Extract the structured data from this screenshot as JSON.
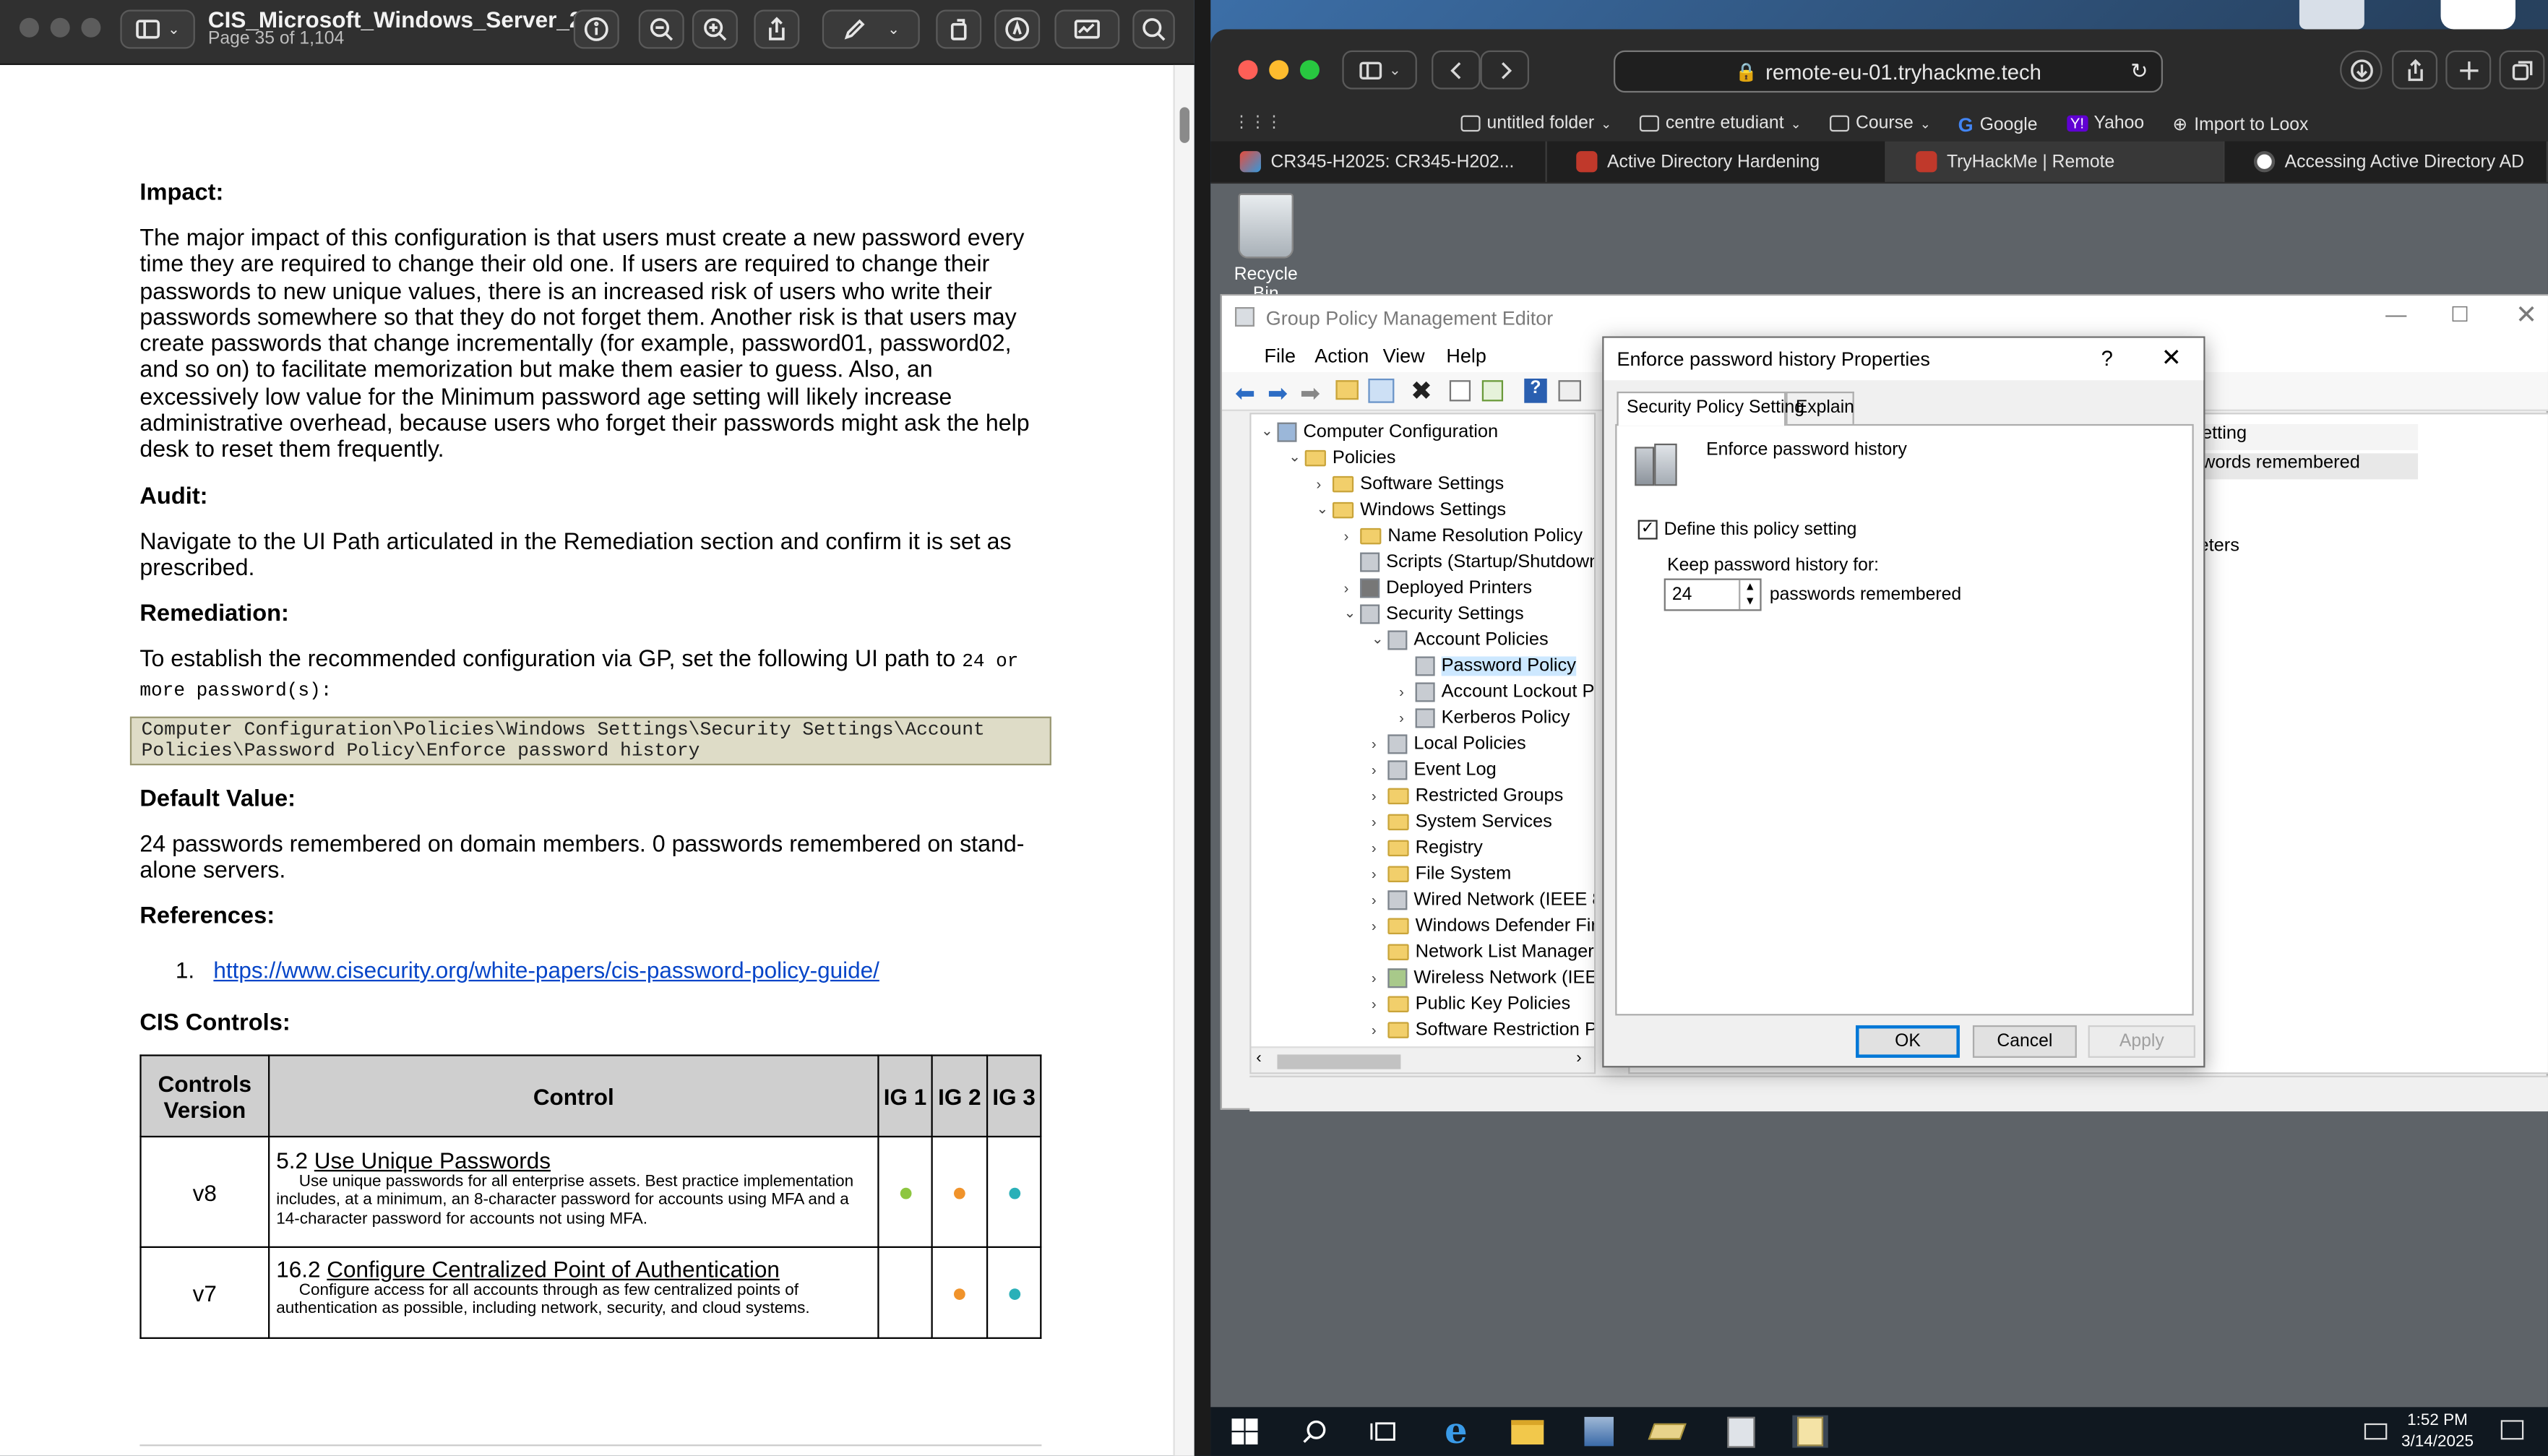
{
  "preview": {
    "title": "CIS_Microsoft_Windows_Server_2...",
    "page_indicator": "Page 35 of 1,104"
  },
  "document": {
    "impact_heading": "Impact:",
    "impact_text": "The major impact of this configuration is that users must create a new password every time they are required to change their old one. If users are required to change their passwords to new unique values, there is an increased risk of users who write their passwords somewhere so that they do not forget them. Another risk is that users may create passwords that change incrementally (for example, password01, password02, and so on) to facilitate memorization but make them easier to guess. Also, an excessively low value for the Minimum password age setting will likely increase administrative overhead, because users who forget their passwords might ask the help desk to reset them frequently.",
    "audit_heading": "Audit:",
    "audit_text": "Navigate to the UI Path articulated in the Remediation section and confirm it is set as prescribed.",
    "remediation_heading": "Remediation:",
    "remediation_text": "To establish the recommended configuration via GP, set the following UI path to",
    "remediation_value": "24 or more password(s):",
    "remediation_path": "Computer Configuration\\Policies\\Windows Settings\\Security Settings\\Account Policies\\Password Policy\\Enforce password history",
    "default_heading": "Default Value:",
    "default_text": "24 passwords remembered on domain members. 0 passwords remembered on stand-alone servers.",
    "references_heading": "References:",
    "reference_number": "1.",
    "reference_url": "https://www.cisecurity.org/white-papers/cis-password-policy-guide/",
    "cis_heading": "CIS Controls:",
    "table": {
      "headers": [
        "Controls Version",
        "Control",
        "IG 1",
        "IG 2",
        "IG 3"
      ],
      "rows": [
        {
          "version": "v8",
          "number": "5.2",
          "title": "Use Unique Passwords",
          "desc": "Use unique passwords for all enterprise assets. Best practice implementation includes, at a minimum, an 8-character password for accounts using MFA and a 14-character password for accounts not using MFA.",
          "ig": [
            true,
            true,
            true
          ]
        },
        {
          "version": "v7",
          "number": "16.2",
          "title": "Configure Centralized Point of Authentication",
          "desc": "Configure access for all accounts through as few centralized points of authentication as possible, including network, security, and cloud systems.",
          "ig": [
            false,
            true,
            true
          ]
        }
      ],
      "ig_colors": [
        "#8dc63f",
        "#f0932b",
        "#2ab0b8"
      ]
    }
  },
  "safari": {
    "url": "remote-eu-01.tryhackme.tech",
    "favorites": [
      "untitled folder",
      "centre etudiant",
      "Course",
      "Google",
      "Yahoo",
      "Import to Loox"
    ],
    "tabs": [
      "CR345-H2025: CR345-H202...",
      "Active Directory Hardening",
      "TryHackMe | Remote",
      "Accessing Active Directory AD"
    ]
  },
  "desktop": {
    "recycle_bin": "Recycle Bin",
    "clock_time": "1:52 PM",
    "clock_date": "3/14/2025"
  },
  "gpme": {
    "title": "Group Policy Management Editor",
    "menu": [
      "File",
      "Action",
      "View",
      "Help"
    ],
    "tree": [
      "Computer Configuration",
      "Policies",
      "Software Settings",
      "Windows Settings",
      "Name Resolution Policy",
      "Scripts (Startup/Shutdown",
      "Deployed Printers",
      "Security Settings",
      "Account Policies",
      "Password Policy",
      "Account Lockout P",
      "Kerberos Policy",
      "Local Policies",
      "Event Log",
      "Restricted Groups",
      "System Services",
      "Registry",
      "File System",
      "Wired Network (IEEE 8(",
      "Windows Defender Fire",
      "Network List Manager",
      "Wireless Network (IEEE",
      "Public Key Policies",
      "Software Restriction Pc"
    ],
    "right_pane": [
      "etting",
      "words remembered",
      "eters"
    ]
  },
  "dialog": {
    "title": "Enforce password history Properties",
    "help": "?",
    "tabs": [
      "Security Policy Setting",
      "Explain"
    ],
    "policy_name": "Enforce password history",
    "define_label": "Define this policy setting",
    "keep_label": "Keep password history for:",
    "value": "24",
    "unit": "passwords remembered",
    "ok": "OK",
    "cancel": "Cancel",
    "apply": "Apply"
  }
}
